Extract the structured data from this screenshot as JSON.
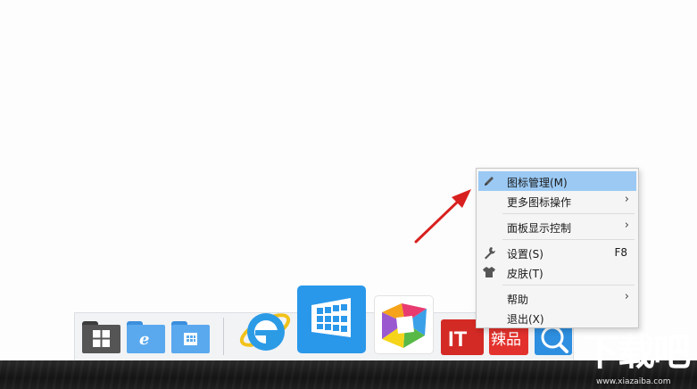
{
  "context_menu": {
    "items": [
      {
        "label": "图标管理(M)",
        "icon": "pencil-icon",
        "highlighted": true
      },
      {
        "label": "更多图标操作",
        "submenu": true
      },
      {
        "label": "面板显示控制",
        "submenu": true
      },
      {
        "label": "设置(S)",
        "icon": "wrench-icon",
        "shortcut": "F8"
      },
      {
        "label": "皮肤(T)",
        "icon": "shirt-icon"
      },
      {
        "label": "帮助",
        "submenu": true
      },
      {
        "label": "退出(X)"
      }
    ],
    "submenu_glyph": "›"
  },
  "dock": {
    "icons": [
      "folder-windows-icon",
      "folder-ie-icon",
      "folder-store-icon",
      "ie-browser-icon",
      "windows-store-icon",
      "colorful-app-icon",
      "ithome-icon",
      "lapin-icon",
      "search-icon"
    ],
    "app_labels": {
      "ithome": "IT",
      "lapin": "辣品"
    }
  },
  "watermark": {
    "name": "下载吧",
    "url": "www.xiazaiba.com"
  },
  "colors": {
    "highlight": "#9bc9f4",
    "arrow": "#d8211f",
    "folder_dark": "#4a4a4a",
    "folder_blue": "#4aa0e8"
  }
}
